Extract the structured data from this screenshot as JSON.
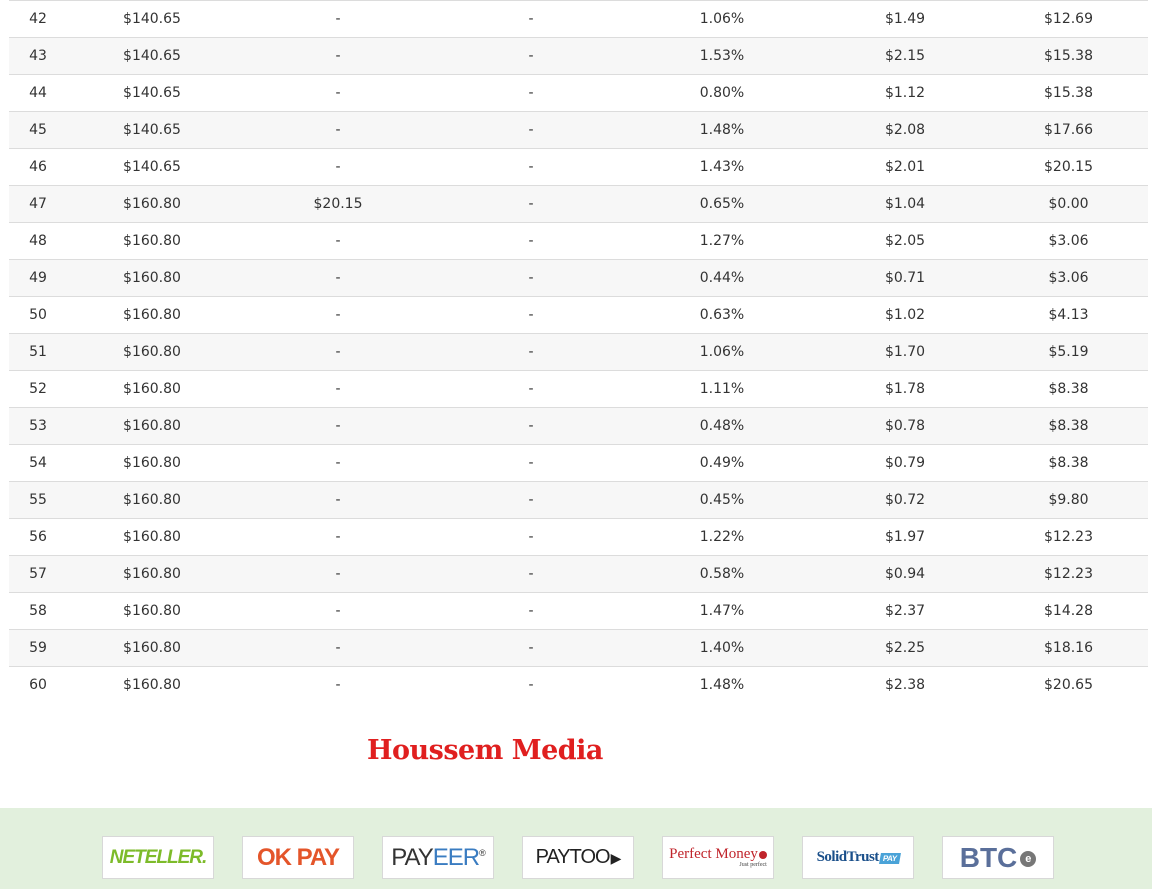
{
  "table": {
    "rows": [
      [
        "42",
        "$140.65",
        "-",
        "-",
        "1.06%",
        "$1.49",
        "$12.69"
      ],
      [
        "43",
        "$140.65",
        "-",
        "-",
        "1.53%",
        "$2.15",
        "$15.38"
      ],
      [
        "44",
        "$140.65",
        "-",
        "-",
        "0.80%",
        "$1.12",
        "$15.38"
      ],
      [
        "45",
        "$140.65",
        "-",
        "-",
        "1.48%",
        "$2.08",
        "$17.66"
      ],
      [
        "46",
        "$140.65",
        "-",
        "-",
        "1.43%",
        "$2.01",
        "$20.15"
      ],
      [
        "47",
        "$160.80",
        "$20.15",
        "-",
        "0.65%",
        "$1.04",
        "$0.00"
      ],
      [
        "48",
        "$160.80",
        "-",
        "-",
        "1.27%",
        "$2.05",
        "$3.06"
      ],
      [
        "49",
        "$160.80",
        "-",
        "-",
        "0.44%",
        "$0.71",
        "$3.06"
      ],
      [
        "50",
        "$160.80",
        "-",
        "-",
        "0.63%",
        "$1.02",
        "$4.13"
      ],
      [
        "51",
        "$160.80",
        "-",
        "-",
        "1.06%",
        "$1.70",
        "$5.19"
      ],
      [
        "52",
        "$160.80",
        "-",
        "-",
        "1.11%",
        "$1.78",
        "$8.38"
      ],
      [
        "53",
        "$160.80",
        "-",
        "-",
        "0.48%",
        "$0.78",
        "$8.38"
      ],
      [
        "54",
        "$160.80",
        "-",
        "-",
        "0.49%",
        "$0.79",
        "$8.38"
      ],
      [
        "55",
        "$160.80",
        "-",
        "-",
        "0.45%",
        "$0.72",
        "$9.80"
      ],
      [
        "56",
        "$160.80",
        "-",
        "-",
        "1.22%",
        "$1.97",
        "$12.23"
      ],
      [
        "57",
        "$160.80",
        "-",
        "-",
        "0.58%",
        "$0.94",
        "$12.23"
      ],
      [
        "58",
        "$160.80",
        "-",
        "-",
        "1.47%",
        "$2.37",
        "$14.28"
      ],
      [
        "59",
        "$160.80",
        "-",
        "-",
        "1.40%",
        "$2.25",
        "$18.16"
      ],
      [
        "60",
        "$160.80",
        "-",
        "-",
        "1.48%",
        "$2.38",
        "$20.65"
      ]
    ]
  },
  "watermark": {
    "text": "Houssem Media",
    "color": "#e01f1f"
  },
  "footer": {
    "background": "#e2f0dd",
    "payment_logos": [
      {
        "name": "neteller",
        "text": "NETELLER.",
        "color": "#7dbb2a"
      },
      {
        "name": "okpay",
        "text": "OK PAY",
        "color": "#e4552a"
      },
      {
        "name": "payeer",
        "text_a": "PAY",
        "text_b": "EER",
        "mark": "®",
        "color": "#3a7cc1"
      },
      {
        "name": "paytoo",
        "text": "PAYTOO",
        "color": "#222222"
      },
      {
        "name": "perfect-money",
        "text": "Perfect Money",
        "sub": "Just perfect",
        "color": "#c0242b"
      },
      {
        "name": "solidtrust-pay",
        "text": "SolidTrust",
        "badge": "PAY",
        "color": "#1a4f8a"
      },
      {
        "name": "btc-e",
        "text": "BTC",
        "badge": "e",
        "color": "#5a6f9a"
      }
    ]
  }
}
